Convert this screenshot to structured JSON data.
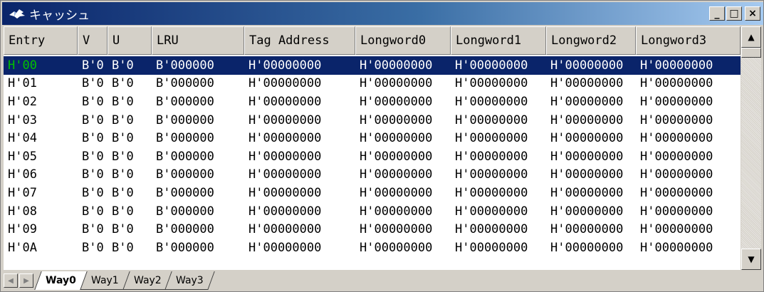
{
  "window": {
    "title": "キャッシュ",
    "icon": "cache-app-icon",
    "buttons": {
      "minimize": "_",
      "maximize": "□",
      "close": "×"
    }
  },
  "columns": [
    "Entry",
    "V",
    "U",
    "LRU",
    "Tag Address",
    "Longword0",
    "Longword1",
    "Longword2",
    "Longword3"
  ],
  "rows": [
    [
      "H'00",
      "B'0",
      "B'0",
      "B'000000",
      "H'00000000",
      "H'00000000",
      "H'00000000",
      "H'00000000",
      "H'00000000"
    ],
    [
      "H'01",
      "B'0",
      "B'0",
      "B'000000",
      "H'00000000",
      "H'00000000",
      "H'00000000",
      "H'00000000",
      "H'00000000"
    ],
    [
      "H'02",
      "B'0",
      "B'0",
      "B'000000",
      "H'00000000",
      "H'00000000",
      "H'00000000",
      "H'00000000",
      "H'00000000"
    ],
    [
      "H'03",
      "B'0",
      "B'0",
      "B'000000",
      "H'00000000",
      "H'00000000",
      "H'00000000",
      "H'00000000",
      "H'00000000"
    ],
    [
      "H'04",
      "B'0",
      "B'0",
      "B'000000",
      "H'00000000",
      "H'00000000",
      "H'00000000",
      "H'00000000",
      "H'00000000"
    ],
    [
      "H'05",
      "B'0",
      "B'0",
      "B'000000",
      "H'00000000",
      "H'00000000",
      "H'00000000",
      "H'00000000",
      "H'00000000"
    ],
    [
      "H'06",
      "B'0",
      "B'0",
      "B'000000",
      "H'00000000",
      "H'00000000",
      "H'00000000",
      "H'00000000",
      "H'00000000"
    ],
    [
      "H'07",
      "B'0",
      "B'0",
      "B'000000",
      "H'00000000",
      "H'00000000",
      "H'00000000",
      "H'00000000",
      "H'00000000"
    ],
    [
      "H'08",
      "B'0",
      "B'0",
      "B'000000",
      "H'00000000",
      "H'00000000",
      "H'00000000",
      "H'00000000",
      "H'00000000"
    ],
    [
      "H'09",
      "B'0",
      "B'0",
      "B'000000",
      "H'00000000",
      "H'00000000",
      "H'00000000",
      "H'00000000",
      "H'00000000"
    ],
    [
      "H'0A",
      "B'0",
      "B'0",
      "B'000000",
      "H'00000000",
      "H'00000000",
      "H'00000000",
      "H'00000000",
      "H'00000000"
    ]
  ],
  "selected_row": 0,
  "tabs": [
    "Way0",
    "Way1",
    "Way2",
    "Way3"
  ],
  "active_tab": 0,
  "colors": {
    "title_start": "#0a246a",
    "title_end": "#a6caf0",
    "selection_bg": "#0a246a",
    "selected_entry_text": "#00c000",
    "face": "#d4d0c8"
  }
}
